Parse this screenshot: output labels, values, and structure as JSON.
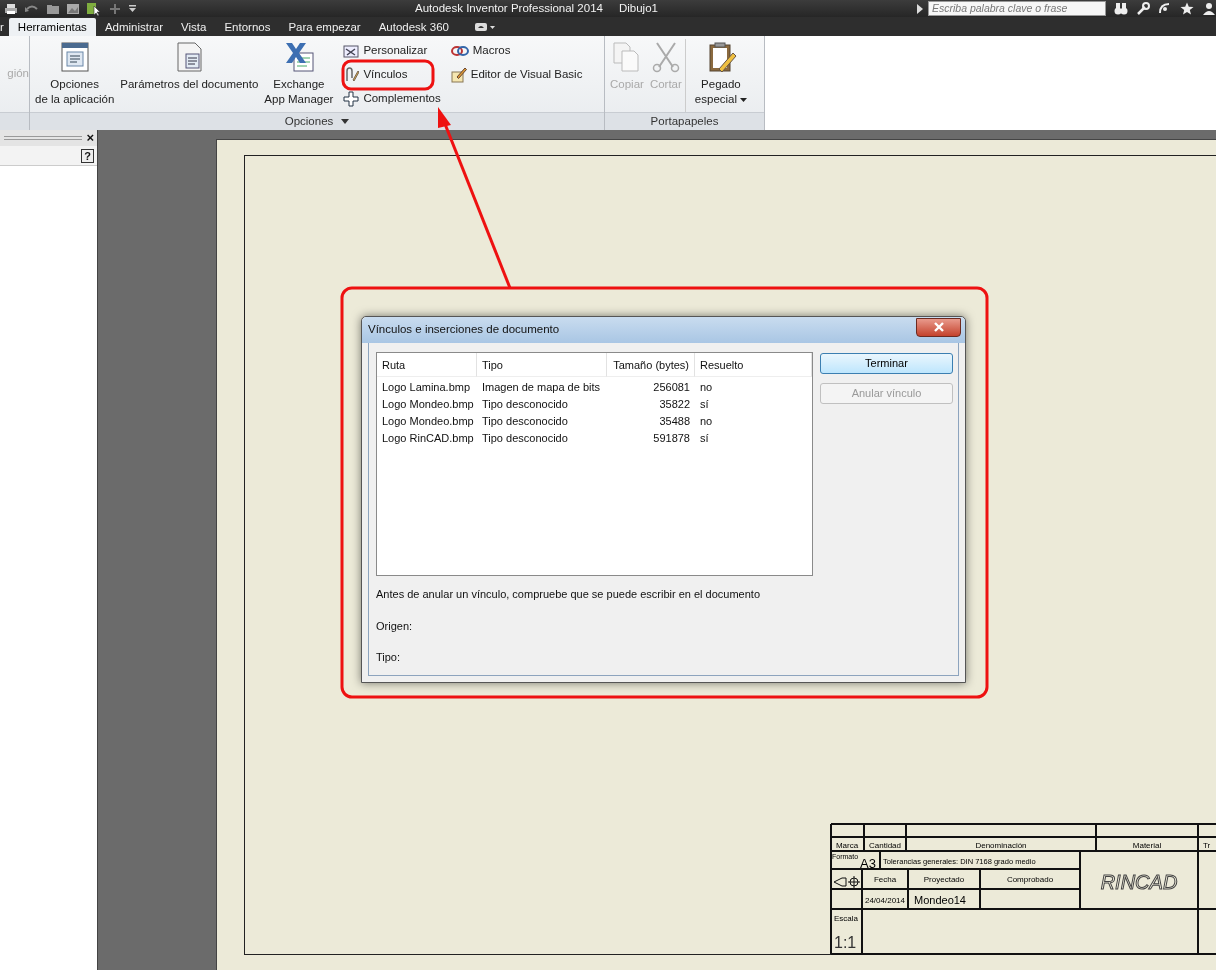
{
  "window": {
    "title": "Autodesk Inventor Professional 2014",
    "document": "Dibujo1"
  },
  "search": {
    "placeholder": "Escriba palabra clave o frase"
  },
  "tabs": [
    {
      "label": "r",
      "selected": false
    },
    {
      "label": "Herramientas",
      "selected": true
    },
    {
      "label": "Administrar",
      "selected": false
    },
    {
      "label": "Vista",
      "selected": false
    },
    {
      "label": "Entornos",
      "selected": false
    },
    {
      "label": "Para empezar",
      "selected": false
    },
    {
      "label": "Autodesk 360",
      "selected": false
    }
  ],
  "ribbon": {
    "cut_label": "gión",
    "panels": [
      {
        "title": "Opciones",
        "menu": true,
        "columns": [
          {
            "items": [
              {
                "lines": [
                  "Opciones",
                  "de la aplicación"
                ],
                "kind": "large",
                "disabled": false,
                "dropdown": false
              }
            ]
          },
          {
            "items": [
              {
                "lines": [
                  "Parámetros del documento"
                ],
                "kind": "large",
                "disabled": false,
                "dropdown": false
              }
            ]
          },
          {
            "items": [
              {
                "lines": [
                  "Exchange",
                  "App Manager"
                ],
                "kind": "large",
                "disabled": false,
                "dropdown": false
              }
            ]
          },
          {
            "items": [
              {
                "lines": [
                  "Personalizar"
                ],
                "kind": "small",
                "disabled": false,
                "dropdown": false
              },
              {
                "lines": [
                  "Vínculos"
                ],
                "kind": "small",
                "disabled": false,
                "dropdown": false
              },
              {
                "lines": [
                  "Complementos"
                ],
                "kind": "small",
                "disabled": false,
                "dropdown": false
              }
            ]
          },
          {
            "items": [
              {
                "lines": [
                  "Macros"
                ],
                "kind": "small",
                "disabled": false,
                "dropdown": false
              },
              {
                "lines": [
                  "Editor de Visual Basic"
                ],
                "kind": "small",
                "disabled": false,
                "dropdown": false
              }
            ]
          }
        ]
      },
      {
        "title": "Portapapeles",
        "menu": false,
        "columns": [
          {
            "items": [
              {
                "lines": [
                  "Copiar"
                ],
                "kind": "medium",
                "disabled": true,
                "dropdown": false
              }
            ]
          },
          {
            "items": [
              {
                "lines": [
                  "Cortar"
                ],
                "kind": "medium",
                "disabled": true,
                "dropdown": false
              }
            ]
          },
          {
            "items": [
              {
                "lines": [
                  "Pegado",
                  "especial"
                ],
                "kind": "large",
                "disabled": false,
                "dropdown": true
              }
            ]
          }
        ]
      }
    ]
  },
  "browser_panel": {
    "close": "×",
    "help": "?"
  },
  "title_block": {
    "headers": [
      "Marca",
      "Cantidad",
      "Denominación",
      "Material",
      "Tr"
    ],
    "format_label": "Formato",
    "format": "A3",
    "tolerances": "Tolerancias generales: DIN 7168 grado medio",
    "date_label": "Fecha",
    "designed_label": "Proyectado",
    "checked_label": "Comprobado",
    "date": "24/04/2014",
    "designed_by": "Mondeo14",
    "scale_label": "Escala",
    "scale": "1:1",
    "logo": "RINCAD"
  },
  "dialog": {
    "title": "Vínculos e inserciones de documento",
    "columns": [
      "Ruta",
      "Tipo",
      "Tamaño (bytes)",
      "Resuelto"
    ],
    "rows": [
      {
        "cells": [
          "Logo Lamina.bmp",
          "Imagen de mapa de bits",
          "256081",
          "no"
        ]
      },
      {
        "cells": [
          "Logo Mondeo.bmp",
          "Tipo desconocido",
          "35822",
          "sí"
        ]
      },
      {
        "cells": [
          "Logo Mondeo.bmp",
          "Tipo desconocido",
          "35488",
          "no"
        ]
      },
      {
        "cells": [
          "Logo RinCAD.bmp",
          "Tipo desconocido",
          "591878",
          "sí"
        ]
      }
    ],
    "buttons": [
      {
        "label": "Terminar",
        "default": true,
        "disabled": false
      },
      {
        "label": "Anular vínculo",
        "default": false,
        "disabled": true
      }
    ],
    "note": "Antes de anular un vínculo, compruebe que se puede escribir en el documento",
    "info": [
      "Origen:",
      "Tipo:"
    ]
  }
}
